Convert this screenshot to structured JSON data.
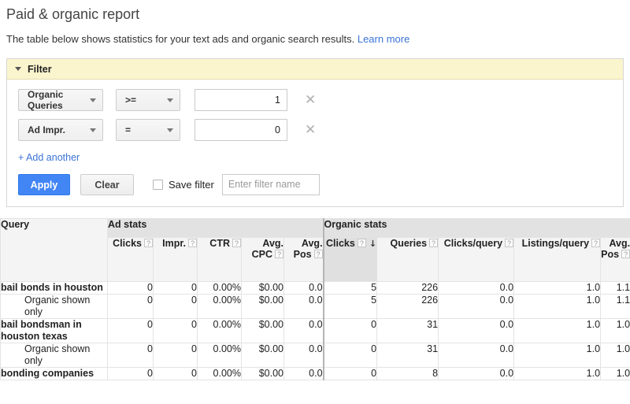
{
  "page": {
    "title": "Paid & organic report",
    "description": "The table below shows statistics for your text ads and organic search results.",
    "learn_more": "Learn more",
    "link_color": "#3b73d6"
  },
  "filter": {
    "header_label": "Filter",
    "header_bg": "#fbf5cd",
    "caret_icon": "caret-down-icon",
    "rows": [
      {
        "field": "Organic Queries",
        "operator": ">=",
        "value": "1",
        "remove_icon": "close-icon"
      },
      {
        "field": "Ad Impr.",
        "operator": "=",
        "value": "0",
        "remove_icon": "close-icon"
      }
    ],
    "add_another_label": "+ Add another",
    "apply_label": "Apply",
    "apply_color": "#4285f4",
    "clear_label": "Clear",
    "save_filter_label": "Save filter",
    "save_filter_checked": false,
    "filter_name_placeholder": "Enter filter name",
    "filter_name_value": ""
  },
  "table": {
    "query_column_header": "Query",
    "groups": [
      {
        "label": "Ad stats",
        "span": 5
      },
      {
        "label": "Organic stats",
        "span": 5
      }
    ],
    "columns": [
      {
        "label": "Clicks",
        "help": "?",
        "group": "ad",
        "sorted": false
      },
      {
        "label": "Impr.",
        "help": "?",
        "group": "ad",
        "sorted": false
      },
      {
        "label": "CTR",
        "help": "?",
        "group": "ad",
        "sorted": false
      },
      {
        "label": "Avg. CPC",
        "help": "?",
        "group": "ad",
        "sorted": false
      },
      {
        "label": "Avg. Pos",
        "help": "?",
        "group": "ad",
        "sorted": false
      },
      {
        "label": "Clicks",
        "help": "?",
        "group": "organic",
        "sorted": true,
        "sort_icon": "arrow-down-icon"
      },
      {
        "label": "Queries",
        "help": "?",
        "group": "organic",
        "sorted": false
      },
      {
        "label": "Clicks/query",
        "help": "?",
        "group": "organic",
        "sorted": false
      },
      {
        "label": "Listings/query",
        "help": "?",
        "group": "organic",
        "sorted": false
      },
      {
        "label": "Avg. Pos",
        "help": "?",
        "group": "organic",
        "sorted": false
      }
    ],
    "rows": [
      {
        "query": "bail bonds in houston",
        "sub": false,
        "ad": [
          "0",
          "0",
          "0.00%",
          "$0.00",
          "0.0"
        ],
        "organic": [
          "5",
          "226",
          "0.0",
          "1.0",
          "1.1"
        ]
      },
      {
        "query": "Organic shown only",
        "sub": true,
        "ad": [
          "0",
          "0",
          "0.00%",
          "$0.00",
          "0.0"
        ],
        "organic": [
          "5",
          "226",
          "0.0",
          "1.0",
          "1.1"
        ]
      },
      {
        "query": "bail bondsman in houston texas",
        "sub": false,
        "ad": [
          "0",
          "0",
          "0.00%",
          "$0.00",
          "0.0"
        ],
        "organic": [
          "0",
          "31",
          "0.0",
          "1.0",
          "1.0"
        ]
      },
      {
        "query": "Organic shown only",
        "sub": true,
        "ad": [
          "0",
          "0",
          "0.00%",
          "$0.00",
          "0.0"
        ],
        "organic": [
          "0",
          "31",
          "0.0",
          "1.0",
          "1.0"
        ]
      },
      {
        "query": "bonding companies",
        "sub": false,
        "ad": [
          "0",
          "0",
          "0.00%",
          "$0.00",
          "0.0"
        ],
        "organic": [
          "0",
          "8",
          "0.0",
          "1.0",
          "1.0"
        ]
      }
    ]
  }
}
